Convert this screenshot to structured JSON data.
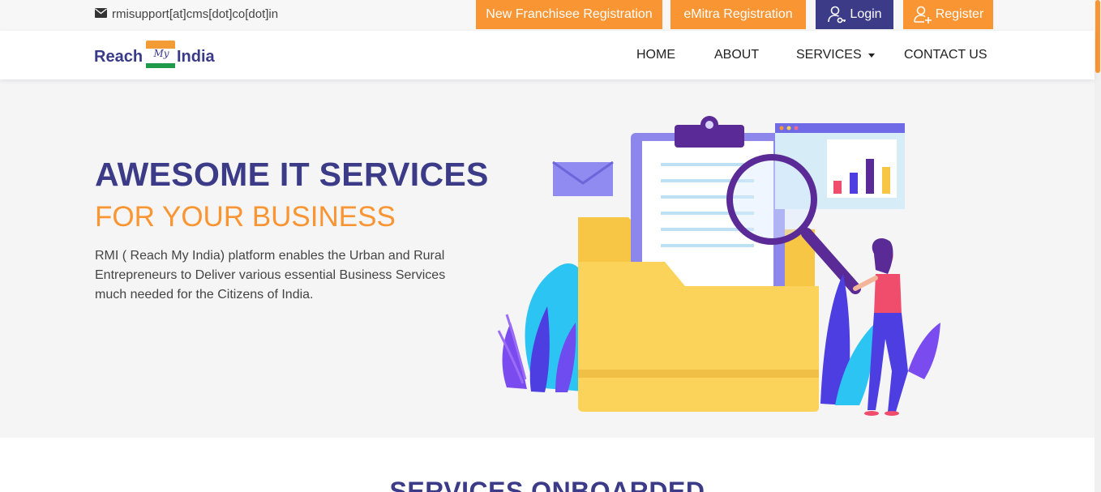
{
  "topbar": {
    "email": "rmisupport[at]cms[dot]co[dot]in",
    "buttons": {
      "franchisee": "New Franchisee Registration",
      "emitra": "eMitra Registration",
      "login": "Login",
      "register": "Register"
    }
  },
  "logo": {
    "word1": "Reach",
    "word2": "My",
    "word3": "India"
  },
  "nav": {
    "home": "HOME",
    "about": "ABOUT",
    "services": "SERVICES",
    "contact": "CONTACT US"
  },
  "hero": {
    "title": "AWESOME IT SERVICES",
    "subtitle": "FOR YOUR BUSINESS",
    "description": "RMI ( Reach My India) platform enables the Urban and Rural Entrepreneurs to Deliver various essential Business Services much needed for the Citizens of India."
  },
  "services": {
    "heading": "SERVICES ONBOARDED"
  },
  "colors": {
    "brand_blue": "#3c3b88",
    "accent_orange": "#fa9533"
  }
}
